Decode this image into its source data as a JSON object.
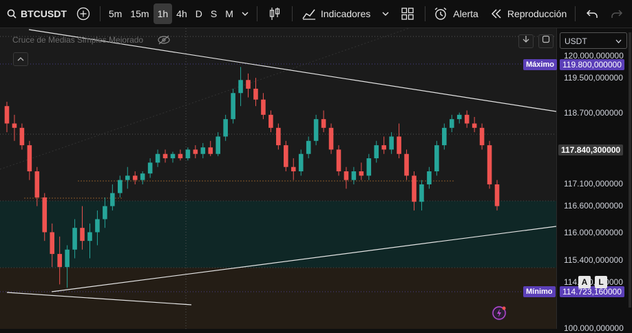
{
  "toolbar": {
    "symbol": "BTCUSDT",
    "intervals": [
      "5m",
      "15m",
      "1h",
      "4h",
      "D",
      "S",
      "M"
    ],
    "active_interval": "1h",
    "indicators_label": "Indicadores",
    "alert_label": "Alerta",
    "replay_label": "Reproducción"
  },
  "chart": {
    "indicator_name": "Cruce de Medias Simples Mejorado",
    "currency": "USDT",
    "max_label": "Máximo",
    "max_value": "119.800,000000",
    "min_label": "Mínimo",
    "min_value": "114.723,160000",
    "current_price": "117.840,300000",
    "axis_labels": [
      "120.000,000000",
      "119.500,000000",
      "118.700,000000",
      "117.100,000000",
      "116.600,000000",
      "116.000,000000",
      "115.400,000000",
      "114.900,000000",
      "100.000,000000"
    ],
    "auto_btn": "A",
    "log_btn": "L",
    "colors": {
      "up": "#26a69a",
      "down": "#ef5350",
      "max_tag": "#5b3fb8",
      "current_tag": "#3a3a3a"
    }
  },
  "chart_data": {
    "type": "candlestick",
    "title": "BTCUSDT",
    "interval": "1h",
    "ylim": [
      114500,
      120000
    ],
    "ohlc": [
      [
        118900,
        119000,
        118300,
        118500
      ],
      [
        118500,
        118700,
        118100,
        118400
      ],
      [
        118400,
        118500,
        117900,
        118000
      ],
      [
        118000,
        118100,
        117200,
        117400
      ],
      [
        117400,
        117500,
        116600,
        116800
      ],
      [
        116800,
        116900,
        115800,
        116000
      ],
      [
        116000,
        116200,
        115200,
        115500
      ],
      [
        115500,
        115900,
        114800,
        115200
      ],
      [
        115200,
        115700,
        114723,
        115600
      ],
      [
        115600,
        116300,
        115400,
        116100
      ],
      [
        116100,
        116600,
        115600,
        115800
      ],
      [
        115800,
        116200,
        115400,
        116000
      ],
      [
        116000,
        116500,
        115700,
        116300
      ],
      [
        116300,
        116800,
        116100,
        116600
      ],
      [
        116600,
        117100,
        116500,
        116900
      ],
      [
        116900,
        117300,
        116800,
        117200
      ],
      [
        117200,
        117500,
        117000,
        117300
      ],
      [
        117300,
        117400,
        117100,
        117200
      ],
      [
        117200,
        117400,
        117100,
        117350
      ],
      [
        117350,
        117700,
        117250,
        117600
      ],
      [
        117600,
        117900,
        117500,
        117800
      ],
      [
        117800,
        117900,
        117600,
        117700
      ],
      [
        117700,
        117850,
        117600,
        117800
      ],
      [
        117800,
        117900,
        117650,
        117700
      ],
      [
        117700,
        117950,
        117650,
        117900
      ],
      [
        117900,
        118000,
        117700,
        117800
      ],
      [
        117800,
        118050,
        117700,
        117950
      ],
      [
        117950,
        118100,
        117750,
        117800
      ],
      [
        117800,
        118300,
        117750,
        118200
      ],
      [
        118200,
        118700,
        118100,
        118600
      ],
      [
        118600,
        119300,
        118500,
        119200
      ],
      [
        119200,
        119800,
        118900,
        119500
      ],
      [
        119500,
        119650,
        119100,
        119300
      ],
      [
        119300,
        119550,
        118900,
        119050
      ],
      [
        119050,
        119200,
        118600,
        118700
      ],
      [
        118700,
        118800,
        118300,
        118400
      ],
      [
        118400,
        118500,
        117900,
        118000
      ],
      [
        118000,
        118100,
        117400,
        117500
      ],
      [
        117500,
        117700,
        117200,
        117400
      ],
      [
        117400,
        117900,
        117300,
        117800
      ],
      [
        117800,
        118200,
        117700,
        118100
      ],
      [
        118100,
        118700,
        118000,
        118600
      ],
      [
        118600,
        118800,
        118300,
        118400
      ],
      [
        118400,
        118500,
        117800,
        117900
      ],
      [
        117900,
        118000,
        117300,
        117400
      ],
      [
        117400,
        117500,
        117000,
        117200
      ],
      [
        117200,
        117500,
        117100,
        117400
      ],
      [
        117400,
        117600,
        117200,
        117300
      ],
      [
        117300,
        117800,
        117200,
        117700
      ],
      [
        117700,
        118100,
        117600,
        118000
      ],
      [
        118000,
        118200,
        117800,
        117900
      ],
      [
        117900,
        118300,
        117800,
        118200
      ],
      [
        118200,
        118500,
        117700,
        117800
      ],
      [
        117800,
        117900,
        117200,
        117300
      ],
      [
        117300,
        117400,
        116500,
        116700
      ],
      [
        116700,
        117200,
        116500,
        117100
      ],
      [
        117100,
        117500,
        117000,
        117400
      ],
      [
        117400,
        118100,
        117300,
        118000
      ],
      [
        118000,
        118500,
        117900,
        118400
      ],
      [
        118400,
        118700,
        118300,
        118600
      ],
      [
        118600,
        118750,
        118500,
        118700
      ],
      [
        118700,
        118800,
        118400,
        118500
      ],
      [
        118500,
        118650,
        118300,
        118400
      ],
      [
        118400,
        118500,
        117900,
        118000
      ],
      [
        118000,
        118100,
        117000,
        117100
      ],
      [
        117100,
        117200,
        116500,
        116600
      ]
    ]
  }
}
